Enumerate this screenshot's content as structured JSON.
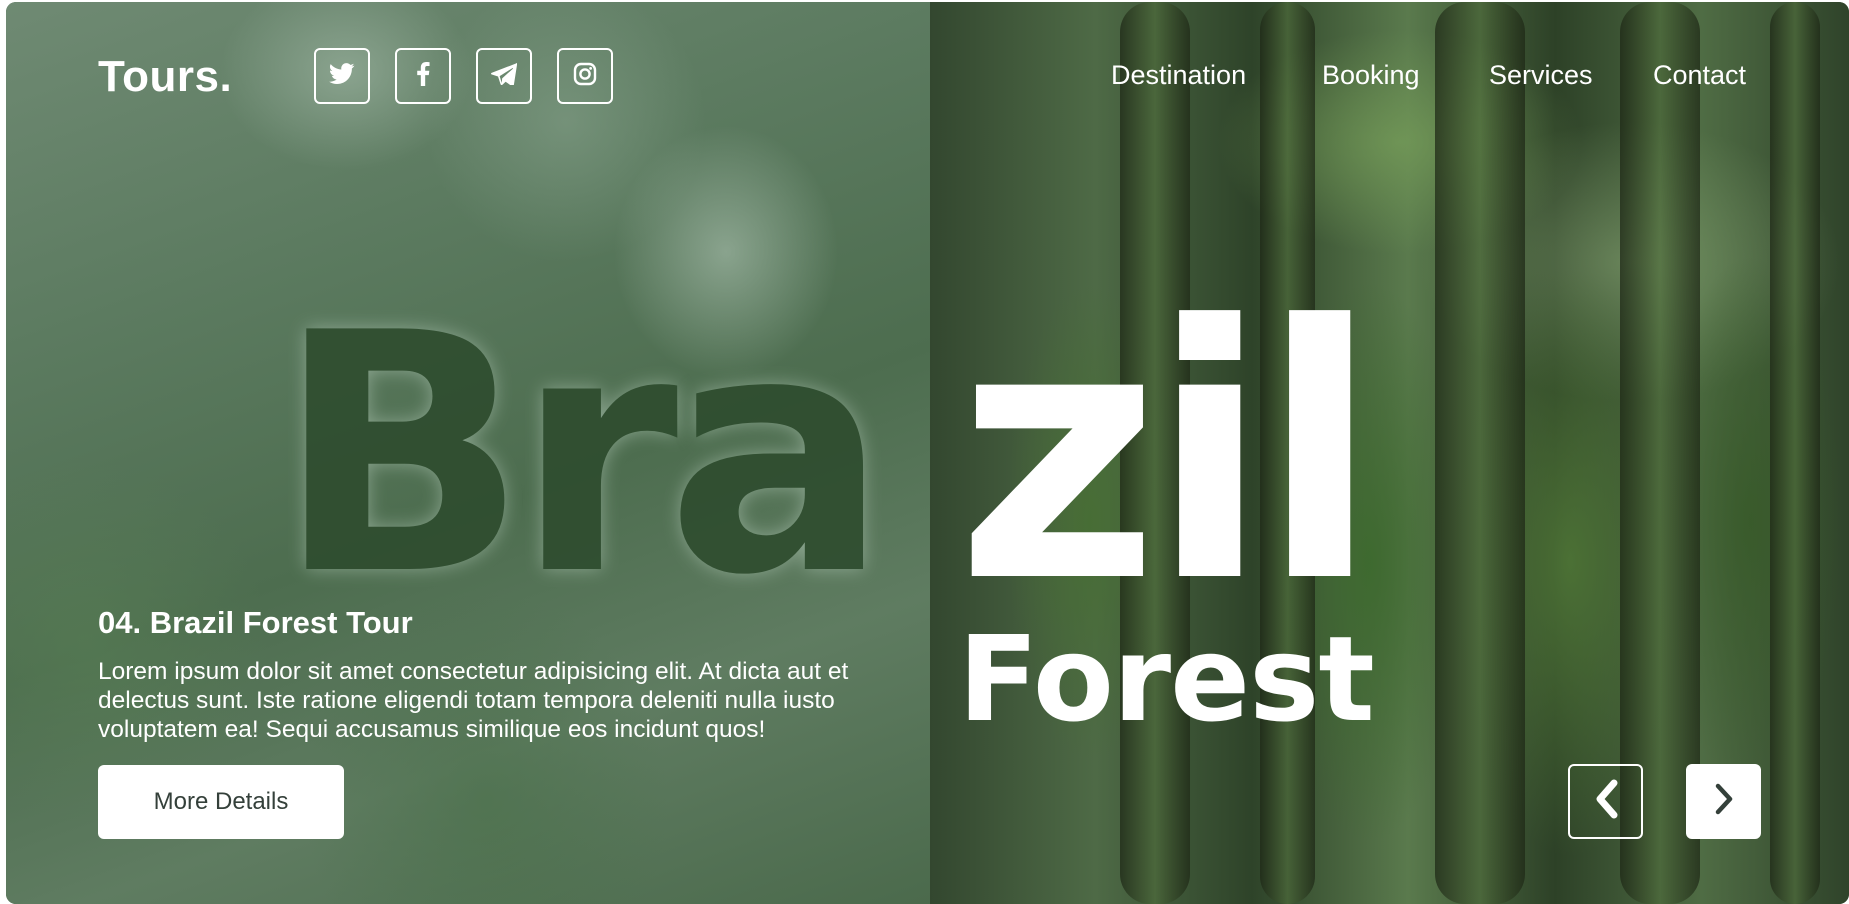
{
  "brand": {
    "logo": "Tours."
  },
  "social": [
    {
      "icon": "twitter-icon"
    },
    {
      "icon": "facebook-icon"
    },
    {
      "icon": "telegram-icon"
    },
    {
      "icon": "instagram-icon"
    }
  ],
  "nav": {
    "items": [
      {
        "label": "Destination"
      },
      {
        "label": "Booking"
      },
      {
        "label": "Services"
      },
      {
        "label": "Contact"
      }
    ]
  },
  "hero": {
    "headline_part1": "Bra",
    "headline_part2": "zil",
    "subheadline": "Forest",
    "tour_title": "04. Brazil Forest Tour",
    "description": "Lorem ipsum dolor sit amet consectetur adipisicing elit. At dicta aut et delectus sunt. Iste ratione eligendi totam tempora deleniti nulla iusto voluptatem ea! Sequi accusamus similique eos incidunt quos!",
    "cta_label": "More Details"
  },
  "slider": {
    "prev_icon": "chevron-left-icon",
    "next_icon": "chevron-right-icon"
  },
  "colors": {
    "text": "#ffffff",
    "button_text": "#34403a",
    "forest_green": "#3e5d3f"
  }
}
